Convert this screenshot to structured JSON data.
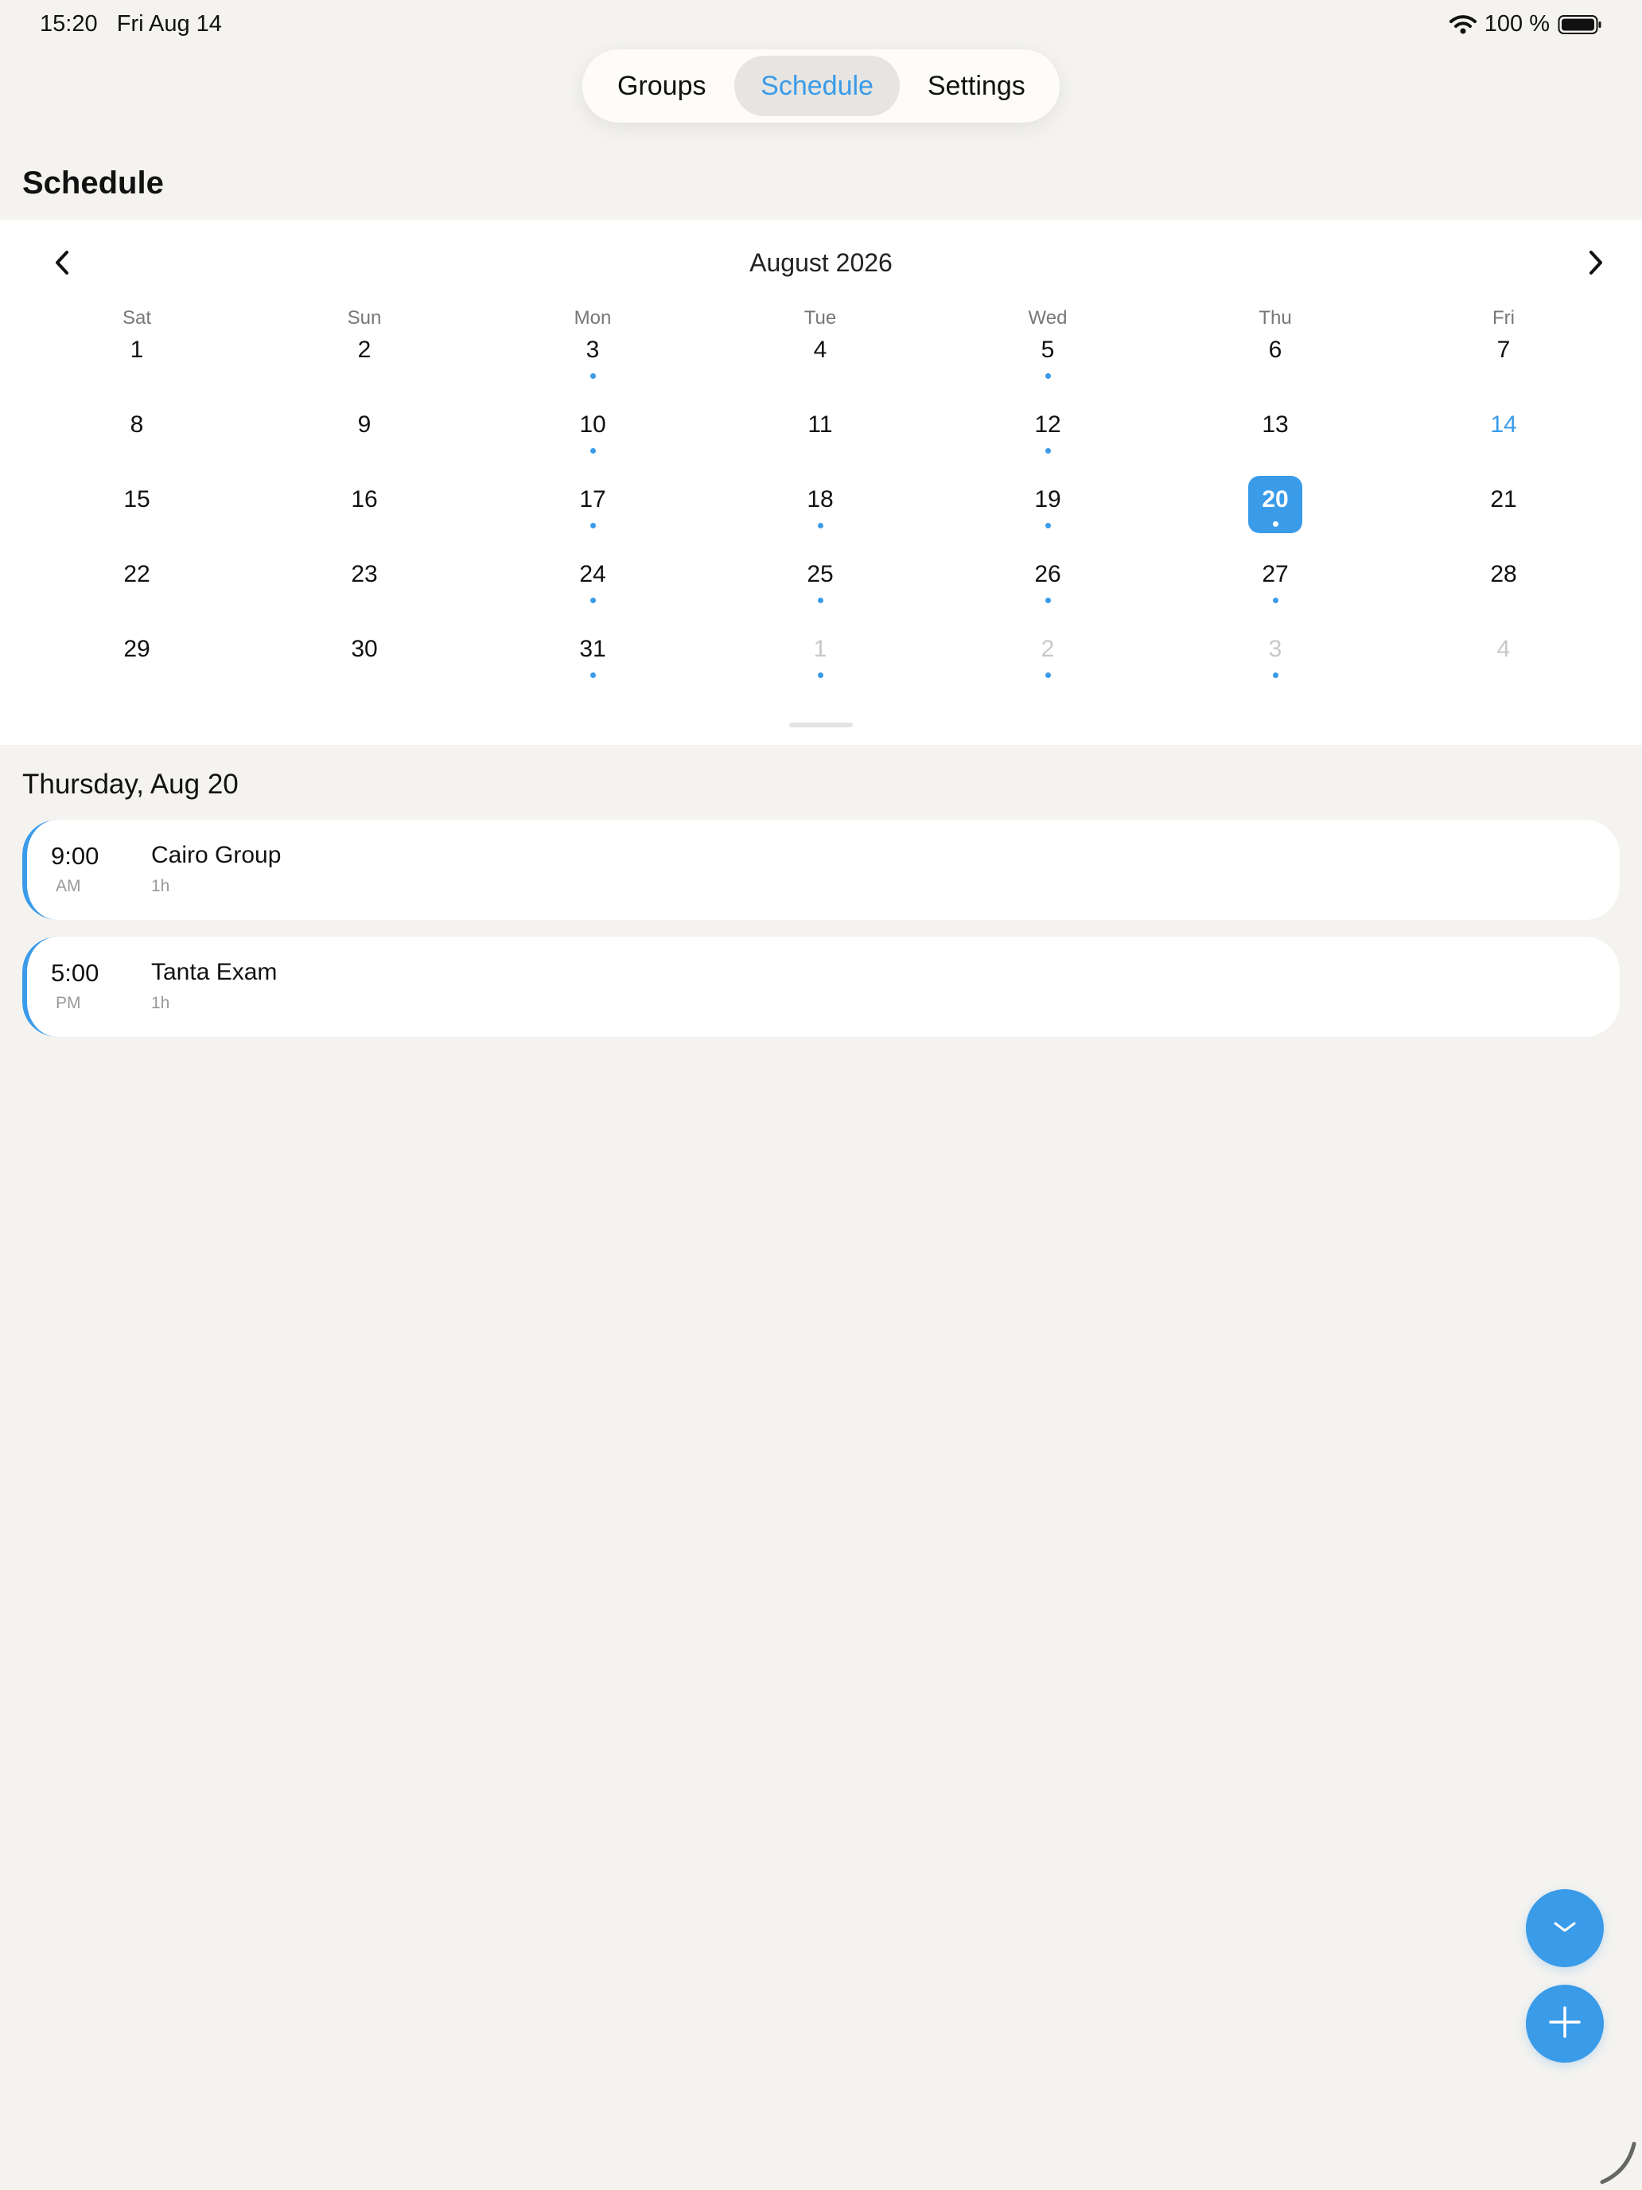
{
  "status_bar": {
    "time": "15:20",
    "date": "Fri Aug 14",
    "battery": "100 %",
    "icons": [
      "wifi-icon",
      "battery-icon"
    ]
  },
  "tabs": [
    {
      "label": "Groups",
      "active": false
    },
    {
      "label": "Schedule",
      "active": true
    },
    {
      "label": "Settings",
      "active": false
    }
  ],
  "page": {
    "title": "Schedule"
  },
  "calendar": {
    "month_label": "August 2026",
    "weekdays": [
      "Sat",
      "Sun",
      "Mon",
      "Tue",
      "Wed",
      "Thu",
      "Fri"
    ],
    "selected_day": 20,
    "today_day": 14,
    "weeks": [
      [
        {
          "d": "1"
        },
        {
          "d": "2"
        },
        {
          "d": "3",
          "dot": true
        },
        {
          "d": "4"
        },
        {
          "d": "5",
          "dot": true
        },
        {
          "d": "6"
        },
        {
          "d": "7"
        }
      ],
      [
        {
          "d": "8"
        },
        {
          "d": "9"
        },
        {
          "d": "10",
          "dot": true
        },
        {
          "d": "11"
        },
        {
          "d": "12",
          "dot": true
        },
        {
          "d": "13"
        },
        {
          "d": "14",
          "today": true
        }
      ],
      [
        {
          "d": "15"
        },
        {
          "d": "16"
        },
        {
          "d": "17",
          "dot": true
        },
        {
          "d": "18",
          "dot": true
        },
        {
          "d": "19",
          "dot": true
        },
        {
          "d": "20",
          "dot": true,
          "selected": true
        },
        {
          "d": "21"
        }
      ],
      [
        {
          "d": "22"
        },
        {
          "d": "23"
        },
        {
          "d": "24",
          "dot": true
        },
        {
          "d": "25",
          "dot": true
        },
        {
          "d": "26",
          "dot": true
        },
        {
          "d": "27",
          "dot": true
        },
        {
          "d": "28"
        }
      ],
      [
        {
          "d": "29"
        },
        {
          "d": "30"
        },
        {
          "d": "31",
          "dot": true
        },
        {
          "d": "1",
          "dot": true,
          "other": true
        },
        {
          "d": "2",
          "dot": true,
          "other": true
        },
        {
          "d": "3",
          "dot": true,
          "other": true
        },
        {
          "d": "4",
          "other": true
        }
      ]
    ]
  },
  "day_view": {
    "heading": "Thursday, Aug 20",
    "events": [
      {
        "time": "9:00",
        "ampm": "AM",
        "title": "Cairo Group",
        "duration": "1h"
      },
      {
        "time": "5:00",
        "ampm": "PM",
        "title": "Tanta Exam",
        "duration": "1h"
      }
    ]
  },
  "colors": {
    "accent": "#3a9be9",
    "background": "#f4f3f0",
    "card": "#ffffff"
  },
  "fabs": [
    {
      "icon": "chevron-down-icon"
    },
    {
      "icon": "plus-icon"
    }
  ]
}
